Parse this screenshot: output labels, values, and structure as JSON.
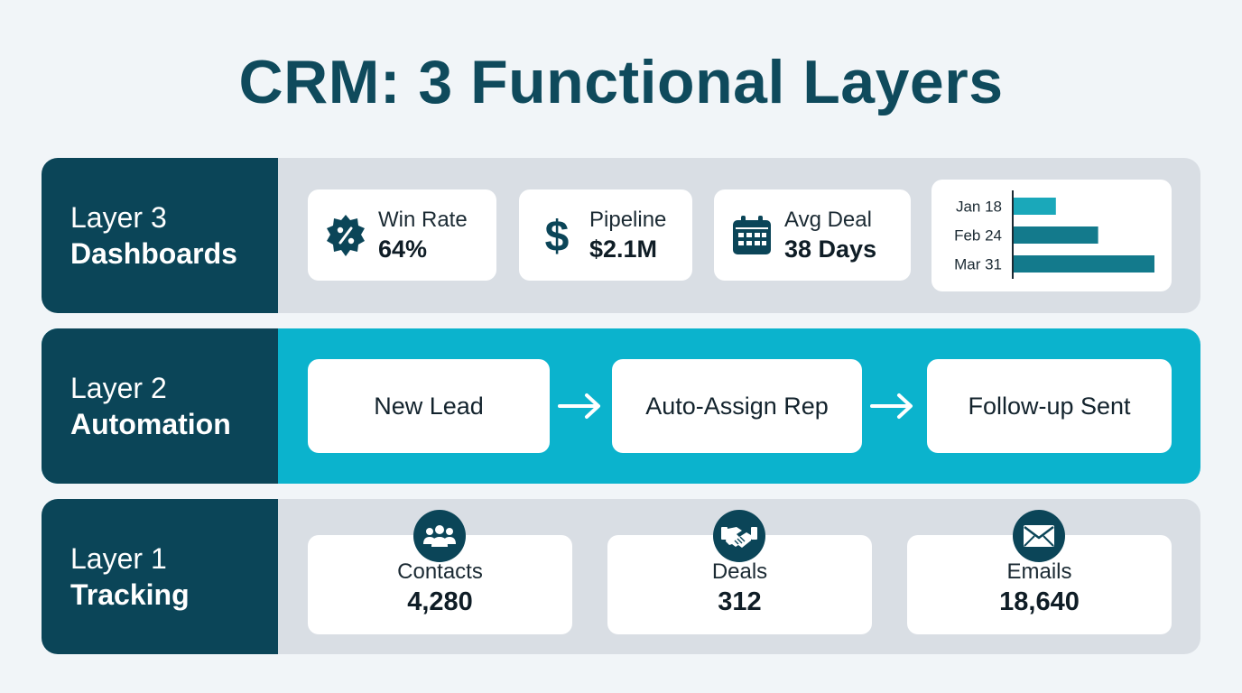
{
  "title": "CRM: 3 Functional Layers",
  "colors": {
    "dark_teal": "#0b4558",
    "cyan": "#0bb3cd",
    "grey_panel": "#d9dee4",
    "bar_fill": "#137a8c",
    "bar_light": "#1aa8ba"
  },
  "layers": {
    "layer3": {
      "number": "Layer 3",
      "name": "Dashboards",
      "kpis": [
        {
          "icon": "percent-badge-icon",
          "label": "Win Rate",
          "value": "64%"
        },
        {
          "icon": "dollar-icon",
          "label": "Pipeline",
          "value": "$2.1M"
        },
        {
          "icon": "calendar-icon",
          "label": "Avg Deal",
          "value": "38 Days"
        }
      ]
    },
    "layer2": {
      "number": "Layer 2",
      "name": "Automation",
      "steps": [
        "New Lead",
        "Auto-Assign Rep",
        "Follow-up Sent"
      ]
    },
    "layer1": {
      "number": "Layer 1",
      "name": "Tracking",
      "items": [
        {
          "icon": "people-icon",
          "label": "Contacts",
          "value": "4,280"
        },
        {
          "icon": "handshake-icon",
          "label": "Deals",
          "value": "312"
        },
        {
          "icon": "envelope-icon",
          "label": "Emails",
          "value": "18,640"
        }
      ]
    }
  },
  "chart_data": {
    "type": "bar",
    "orientation": "horizontal",
    "categories": [
      "Jan 18",
      "Feb 24",
      "Mar 31"
    ],
    "values": [
      0.3,
      0.6,
      1.0
    ],
    "value_scale": "relative (no axis printed)",
    "grid": false
  }
}
